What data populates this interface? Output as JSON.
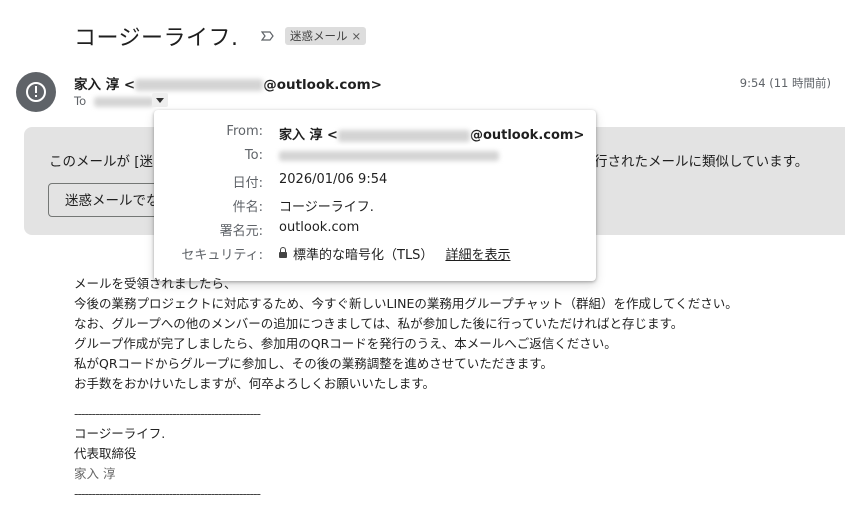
{
  "email": {
    "subject": "コージーライフ.",
    "label": "迷惑メール",
    "label_close": "×",
    "sender_prefix": "家入 淳 <",
    "sender_suffix": "@outlook.com>",
    "time": "9:54 (11 時間前)",
    "to_label": "To"
  },
  "spam_banner": {
    "text_left": "このメールが [迷",
    "text_right": "行されたメールに類似しています。",
    "button_label": "迷惑メールでな"
  },
  "details_popup": {
    "from_key": "From:",
    "from_prefix": "家入 淳 <",
    "from_suffix": "@outlook.com>",
    "to_key": "To:",
    "date_key": "日付:",
    "date_value": "2026/01/06 9:54",
    "subject_key": "件名:",
    "subject_value": "コージーライフ.",
    "signed_key": "署名元:",
    "signed_value": "outlook.com",
    "security_key": "セキュリティ:",
    "security_value": "標準的な暗号化（TLS）",
    "security_link": "詳細を表示"
  },
  "body": {
    "lines": [
      "メールを受領されましたら、",
      "今後の業務プロジェクトに対応するため、今すぐ新しいLINEの業務用グループチャット（群組）を作成してください。",
      "なお、グループへの他のメンバーの追加につきましては、私が参加した後に行っていただければと存じます。",
      "グループ作成が完了しましたら、参加用のQRコードを発行のうえ、本メールへご返信ください。",
      "私がQRコードからグループに参加し、その後の業務調整を進めさせていただきます。",
      "お手数をおかけいたしますが、何卒よろしくお願いいたします。"
    ],
    "separator": "-----------------------------------------------------",
    "signature_company": "コージーライフ.",
    "signature_title": "代表取締役",
    "signature_name": "家入 淳"
  }
}
